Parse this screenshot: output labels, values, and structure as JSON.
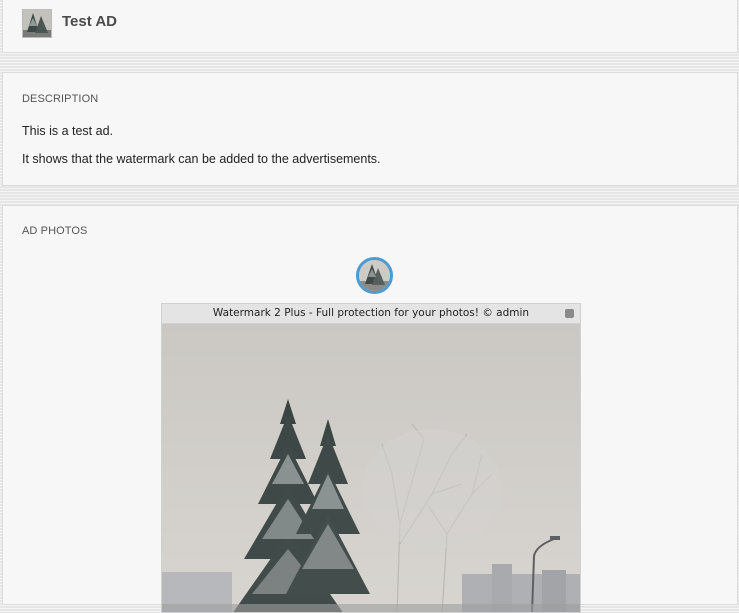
{
  "header": {
    "title": "Test AD"
  },
  "description": {
    "label": "DESCRIPTION",
    "lines": [
      "This is a test ad.",
      "It shows that the watermark can be added to the advertisements."
    ]
  },
  "photos": {
    "label": "AD PHOTOS",
    "watermark_text": "Watermark 2 Plus - Full protection for your photos!  ©  admin",
    "accent_color": "#4f9ad0"
  }
}
